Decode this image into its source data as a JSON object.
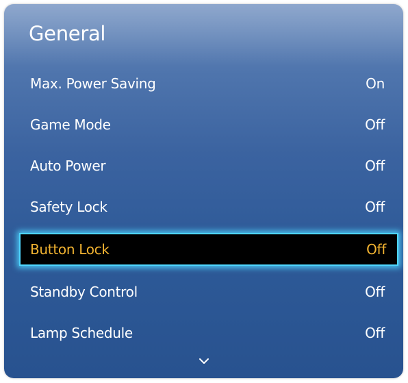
{
  "menu": {
    "title": "General",
    "items": [
      {
        "label": "Max. Power Saving",
        "value": "On"
      },
      {
        "label": "Game Mode",
        "value": "Off"
      },
      {
        "label": "Auto Power",
        "value": "Off"
      },
      {
        "label": "Safety Lock",
        "value": "Off"
      },
      {
        "label": "Button Lock",
        "value": "Off"
      },
      {
        "label": "Standby Control",
        "value": "Off"
      },
      {
        "label": "Lamp Schedule",
        "value": "Off"
      }
    ],
    "selected_item": "Button Lock",
    "scroll_icon": "chevron-down-icon"
  },
  "colors": {
    "panel_blue": "#2e5a98",
    "selected_background": "#000000",
    "selected_text": "#f3b431",
    "focus_glow": "#4fd6ff"
  }
}
